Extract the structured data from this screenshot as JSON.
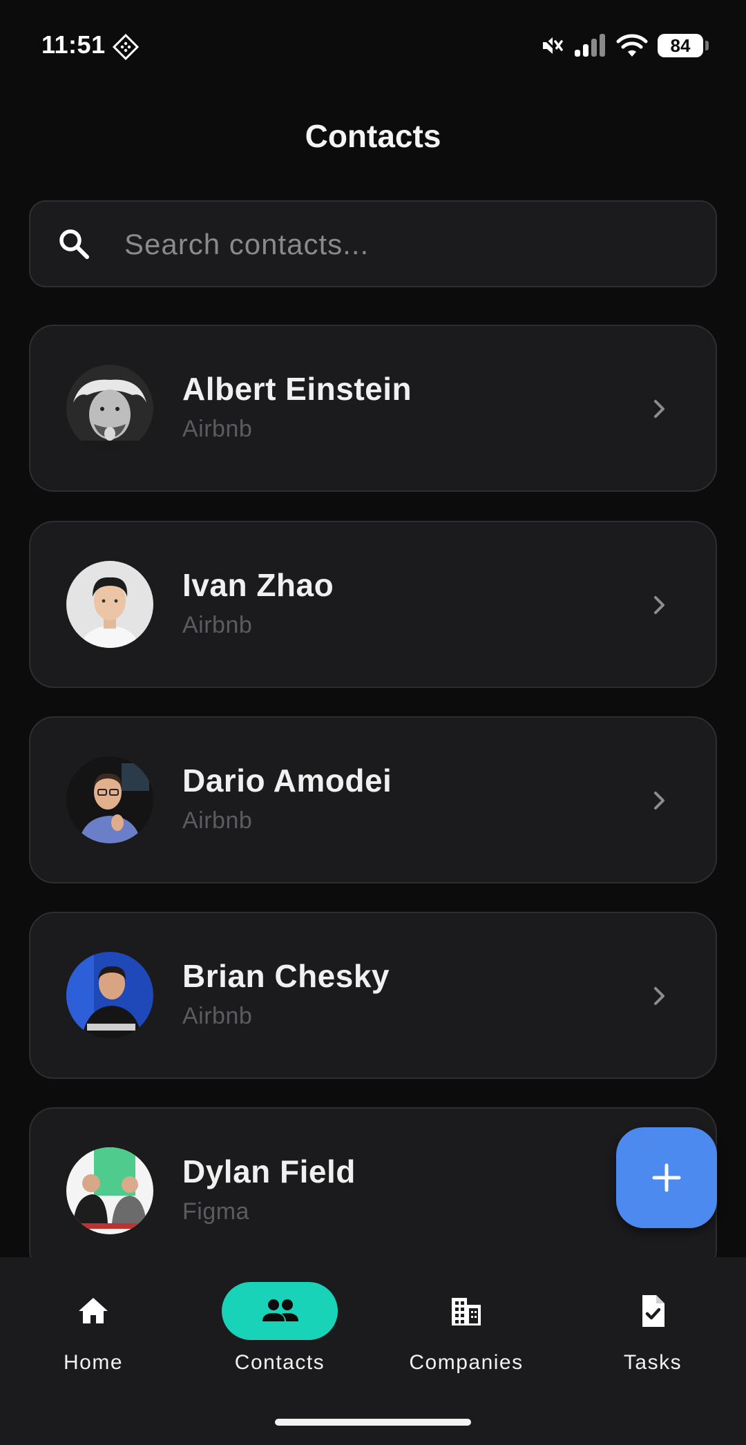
{
  "status_bar": {
    "time": "11:51",
    "battery": "84",
    "icons": [
      "app-notification-icon",
      "mute-icon",
      "signal-icon",
      "wifi-icon",
      "battery-icon"
    ]
  },
  "header": {
    "title": "Contacts"
  },
  "search": {
    "placeholder": "Search contacts...",
    "icon": "search-icon"
  },
  "contacts": [
    {
      "name": "Albert Einstein",
      "company": "Airbnb"
    },
    {
      "name": "Ivan Zhao",
      "company": "Airbnb"
    },
    {
      "name": "Dario Amodei",
      "company": "Airbnb"
    },
    {
      "name": "Brian Chesky",
      "company": "Airbnb"
    },
    {
      "name": "Dylan Field",
      "company": "Figma"
    }
  ],
  "fab": {
    "icon": "plus-icon"
  },
  "bottom_nav": {
    "items": [
      {
        "label": "Home",
        "icon": "home-icon",
        "active": false
      },
      {
        "label": "Contacts",
        "icon": "people-icon",
        "active": true
      },
      {
        "label": "Companies",
        "icon": "building-icon",
        "active": false
      },
      {
        "label": "Tasks",
        "icon": "task-icon",
        "active": false
      }
    ]
  },
  "colors": {
    "background": "#0c0c0d",
    "card": "#1b1b1d",
    "accent_active": "#19d3b8",
    "fab": "#4d8af0",
    "muted_text": "#5c5c60"
  }
}
